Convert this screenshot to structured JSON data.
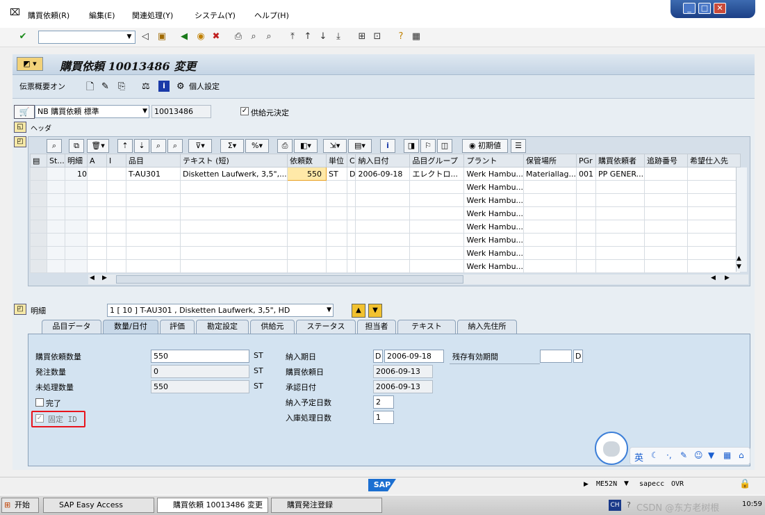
{
  "menu": [
    "購買依頼(R)",
    "編集(E)",
    "関連処理(Y)",
    "システム(Y)",
    "ヘルプ(H)"
  ],
  "window_buttons": [
    "_",
    "□",
    "✕"
  ],
  "command_field": {
    "value": ""
  },
  "title": "購買依頼 10013486 変更",
  "appbar": {
    "overview_label": "伝票概要オン",
    "personal_settings": "個人設定"
  },
  "header": {
    "doc_type": "NB 購買依頼 標準",
    "doc_number": "10013486",
    "source_determination_label": "供給元決定",
    "source_determination_checked": true,
    "header_label": "ヘッダ"
  },
  "grid": {
    "toolbar_initial_values": "初期値",
    "columns": [
      "St...",
      "明細",
      "A",
      "I",
      "品目",
      "テキスト (短)",
      "依頼数",
      "単位",
      "C",
      "納入日付",
      "品目グループ",
      "プラント",
      "保管場所",
      "PGr",
      "購買依頼者",
      "追跡番号",
      "希望仕入先"
    ],
    "rows": [
      [
        "",
        "10",
        "",
        "",
        "T-AU301",
        "Disketten Laufwerk, 3,5\",...",
        "550",
        "ST",
        "D",
        "2006-09-18",
        "エレクトロ...",
        "Werk Hambu...",
        "Materiallag...",
        "001",
        "PP GENER...",
        "",
        ""
      ],
      [
        "",
        "",
        "",
        "",
        "",
        "",
        "",
        "",
        "",
        "",
        "",
        "Werk Hambu...",
        "",
        "",
        "",
        "",
        ""
      ],
      [
        "",
        "",
        "",
        "",
        "",
        "",
        "",
        "",
        "",
        "",
        "",
        "Werk Hambu...",
        "",
        "",
        "",
        "",
        ""
      ],
      [
        "",
        "",
        "",
        "",
        "",
        "",
        "",
        "",
        "",
        "",
        "",
        "Werk Hambu...",
        "",
        "",
        "",
        "",
        ""
      ],
      [
        "",
        "",
        "",
        "",
        "",
        "",
        "",
        "",
        "",
        "",
        "",
        "Werk Hambu...",
        "",
        "",
        "",
        "",
        ""
      ],
      [
        "",
        "",
        "",
        "",
        "",
        "",
        "",
        "",
        "",
        "",
        "",
        "Werk Hambu...",
        "",
        "",
        "",
        "",
        ""
      ],
      [
        "",
        "",
        "",
        "",
        "",
        "",
        "",
        "",
        "",
        "",
        "",
        "Werk Hambu...",
        "",
        "",
        "",
        "",
        ""
      ],
      [
        "",
        "",
        "",
        "",
        "",
        "",
        "",
        "",
        "",
        "",
        "",
        "Werk Hambu...",
        "",
        "",
        "",
        "",
        ""
      ]
    ]
  },
  "detail": {
    "label": "明細",
    "selector": "1 [ 10 ] T-AU301 , Disketten Laufwerk, 3,5\", HD",
    "tabs": [
      "品目データ",
      "数量/日付",
      "評価",
      "勘定設定",
      "供給元",
      "ステータス",
      "担当者",
      "テキスト",
      "納入先住所"
    ],
    "active_tab": "数量/日付"
  },
  "qty": {
    "req_qty_label": "購買依頼数量",
    "req_qty": "550",
    "req_unit": "ST",
    "ordered_label": "発注数量",
    "ordered": "0",
    "ordered_unit": "ST",
    "open_label": "未処理数量",
    "open": "550",
    "open_unit": "ST",
    "done_label": "完了",
    "fixed_id_label": "固定 ID"
  },
  "dates": {
    "delivery_label": "納入期日",
    "delivery_type": "D",
    "delivery": "2006-09-18",
    "request_label": "購買依頼日",
    "request": "2006-09-13",
    "approval_label": "承認日付",
    "approval": "2006-09-13",
    "planned_label": "納入予定日数",
    "planned": "2",
    "gr_label": "入庫処理日数",
    "gr": "1",
    "shelf_label": "残存有効期間",
    "shelf": "",
    "shelf_unit": "D"
  },
  "ime": {
    "lang": "英"
  },
  "status": {
    "sap_logo": "SAP",
    "system": "ME52N",
    "server": "sapecc",
    "mode": "OVR"
  },
  "taskbar": {
    "start": "开始",
    "tasks": [
      "SAP Easy Access",
      "購買依頼 10013486 変更",
      "購買発注登録"
    ],
    "tray_lang": "CH",
    "watermark": "CSDN @东方老树根",
    "clock": "10:59"
  },
  "colors": {
    "highlight_box": "#e8141c",
    "title_bg": "#c5d5e5",
    "panel_bg": "#d3e3f1"
  }
}
